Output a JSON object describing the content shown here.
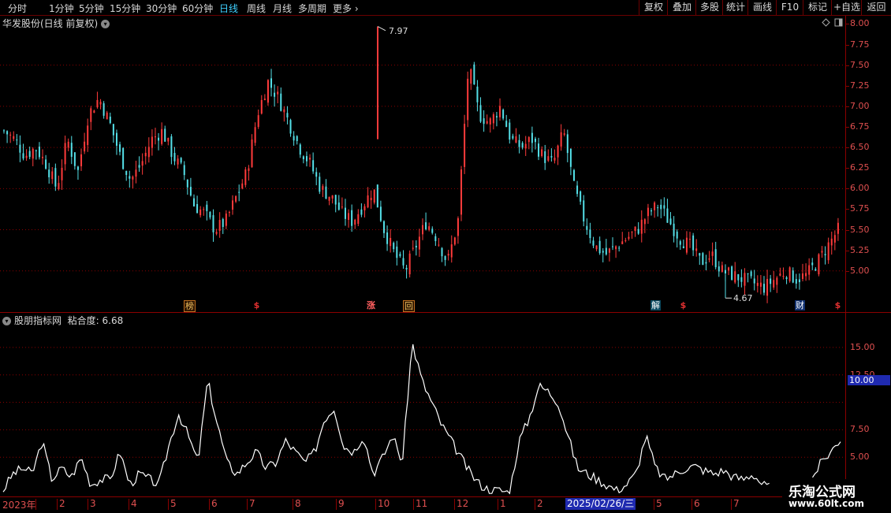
{
  "toolbar": {
    "periods": [
      "分时",
      "1分钟",
      "5分钟",
      "15分钟",
      "30分钟",
      "60分钟",
      "日线",
      "周线",
      "月线",
      "多周期",
      "更多"
    ],
    "buttons": [
      "复权",
      "叠加",
      "多股",
      "统计",
      "画线",
      "F10",
      "标记",
      "+自选",
      "返回"
    ]
  },
  "stock": {
    "title": "华发股份(日线 前复权)"
  },
  "price_axis": {
    "labels": [
      "8.00",
      "7.75",
      "7.50",
      "7.25",
      "7.00",
      "6.75",
      "6.50",
      "6.25",
      "6.00",
      "5.75",
      "5.50",
      "5.25",
      "5.00"
    ]
  },
  "annotations": {
    "high": "7.97",
    "low": "4.67"
  },
  "markers": [
    "榜",
    "$",
    "涨",
    "回",
    "解",
    "$",
    "财",
    "$"
  ],
  "indicator": {
    "title": "股朋指标网",
    "value_label": "粘合度: 6.68",
    "axis_labels": [
      "15.00",
      "12.50",
      "10.00",
      "7.50",
      "5.00"
    ],
    "level": "10.00"
  },
  "time_axis": {
    "labels": [
      "2023年",
      "2",
      "3",
      "4",
      "5",
      "6",
      "7",
      "8",
      "9",
      "10",
      "11",
      "12",
      "1",
      "2",
      "5",
      "6",
      "7"
    ],
    "cursor_date": "2025/02/26/三"
  },
  "watermark": {
    "line1": "乐淘公式网",
    "line2": "www.60lt.com"
  },
  "colors": {
    "up": "#ff3b3b",
    "down": "#54e0e8",
    "grid": "#8b0000",
    "line": "#ffffff"
  },
  "chart_data": [
    {
      "type": "candlestick",
      "title": "华发股份(日线 前复权)",
      "ylim": [
        4.5,
        8.1
      ],
      "series": [
        {
          "name": "close",
          "values": [
            6.7,
            6.6,
            6.4,
            6.5,
            6.3,
            6.0,
            6.6,
            6.2,
            6.9,
            7.1,
            6.8,
            6.4,
            6.1,
            6.3,
            6.6,
            6.7,
            6.4,
            6.2,
            5.8,
            5.7,
            5.5,
            5.6,
            5.9,
            6.2,
            6.9,
            7.3,
            7.1,
            6.8,
            6.5,
            6.3,
            6.0,
            5.9,
            5.7,
            5.6,
            5.8,
            6.0,
            5.5,
            5.2,
            5.0,
            5.3,
            5.6,
            5.4,
            5.1,
            5.6,
            7.5,
            6.9,
            6.8,
            7.0,
            6.6,
            6.5,
            6.6,
            6.4,
            6.3,
            6.7,
            6.0,
            5.6,
            5.3,
            5.2,
            5.3,
            5.4,
            5.5,
            5.7,
            5.8,
            5.6,
            5.4,
            5.3,
            5.1,
            5.2,
            5.0,
            4.95,
            4.9,
            4.85,
            4.8,
            4.9,
            5.0,
            4.9,
            4.95,
            5.1,
            5.3,
            5.5
          ]
        }
      ]
    },
    {
      "type": "line",
      "title": "股朋指标网",
      "ylim": [
        1.5,
        17
      ],
      "series": [
        {
          "name": "粘合度",
          "values": [
            2.0,
            3.5,
            4.0,
            3.5,
            6.5,
            3.0,
            4.0,
            3.2,
            5.0,
            2.5,
            3.0,
            3.0,
            5.5,
            2.5,
            3.5,
            3.0,
            2.5,
            6.0,
            9.0,
            7.0,
            4.5,
            12.0,
            8.0,
            4.5,
            3.5,
            4.5,
            5.5,
            4.0,
            4.5,
            6.5,
            5.5,
            4.5,
            5.5,
            8.5,
            9.5,
            6.0,
            5.5,
            7.0,
            3.5,
            5.0,
            7.0,
            4.5,
            15.5,
            12.0,
            10.0,
            8.0,
            6.5,
            5.0,
            3.5,
            2.5,
            2.0,
            2.0,
            1.8,
            6.5,
            8.5,
            11.5,
            11.0,
            10.0,
            7.0,
            4.0,
            3.5,
            3.0,
            2.5,
            2.0,
            2.5,
            3.5,
            7.0,
            4.0,
            3.0,
            3.5,
            4.0,
            4.2,
            3.8,
            3.5,
            3.8,
            3.2,
            3.0,
            3.5,
            2.5,
            2.2,
            2.0,
            2.5,
            2.2,
            3.0,
            4.5,
            5.5,
            6.7
          ]
        }
      ]
    }
  ]
}
